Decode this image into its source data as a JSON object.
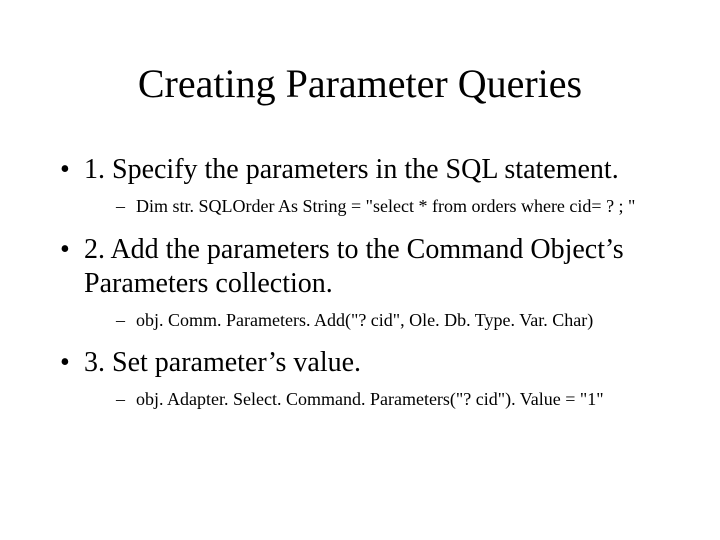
{
  "title": "Creating Parameter Queries",
  "bullets": [
    {
      "text": "1. Specify the parameters in the SQL statement.",
      "sub": [
        "Dim str. SQLOrder As String = \"select * from orders where cid= ? ; \""
      ]
    },
    {
      "text": "2. Add the parameters to the Command Object’s Parameters collection.",
      "sub": [
        "obj. Comm. Parameters. Add(\"? cid\", Ole. Db. Type. Var. Char)"
      ]
    },
    {
      "text": "3. Set parameter’s value.",
      "sub": [
        "obj. Adapter. Select. Command. Parameters(\"? cid\"). Value = \"1\""
      ]
    }
  ]
}
